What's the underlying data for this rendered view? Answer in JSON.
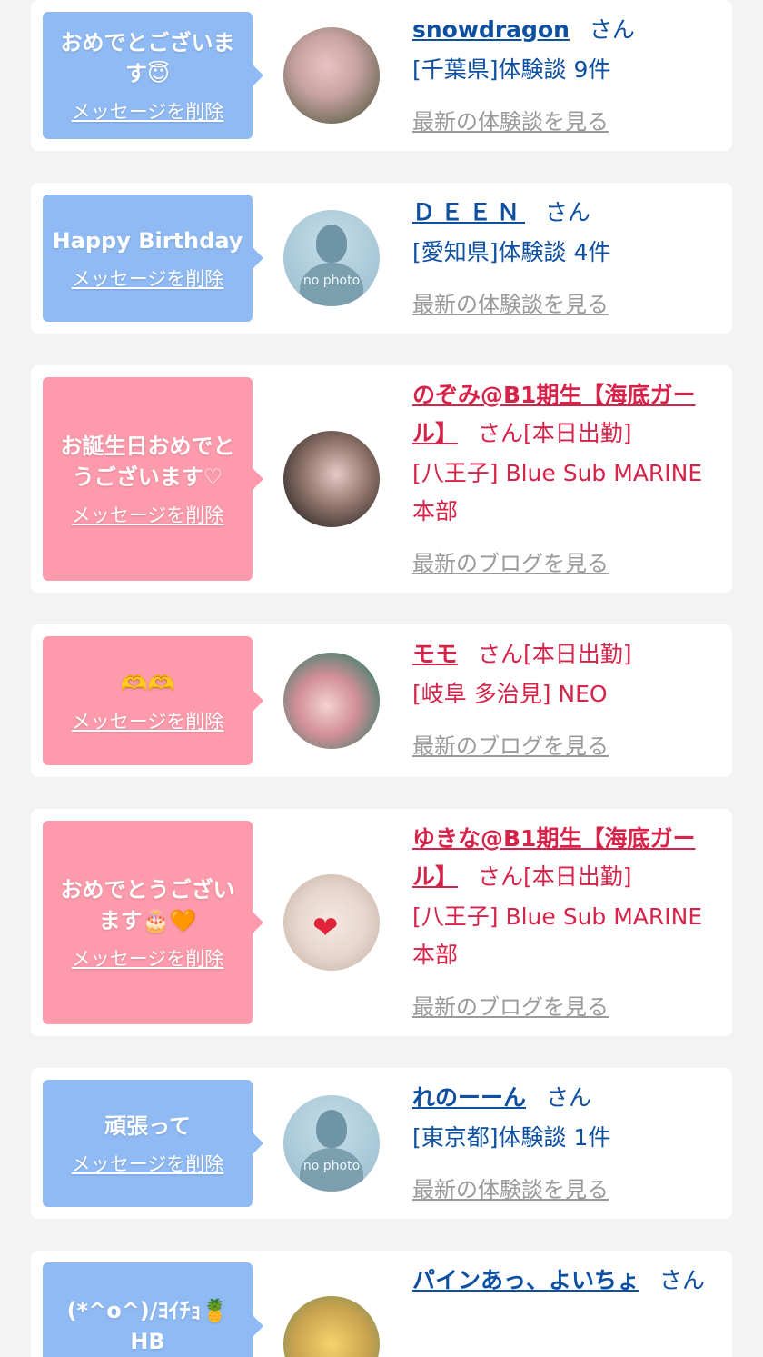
{
  "labels": {
    "delete": "メッセージを削除",
    "san": "さん",
    "latest_review": "最新の体験談を見る",
    "latest_blog": "最新のブログを見る",
    "no_photo": "no photo",
    "on_duty": "[本日出勤]"
  },
  "cards": [
    {
      "message": "おめでとございます😇",
      "name": "snowdragon",
      "detail": "[千葉県]体験談 9件",
      "avatar": "user-photo"
    },
    {
      "message": "Happy Birthday",
      "name": "ＤＥＥＮ",
      "detail": "[愛知県]体験談 4件",
      "avatar": "no-photo"
    },
    {
      "message": "お誕生日おめでとうございます♡",
      "name": "のぞみ@B1期生【海底ガール】",
      "detail": "[八王子] Blue Sub MARINE本部",
      "avatar": "user-photo"
    },
    {
      "message": "🫶🫶",
      "name": "モモ",
      "detail": "[岐阜 多治見] NEO",
      "avatar": "user-photo"
    },
    {
      "message": "おめでとうございます🎂🧡",
      "name": "ゆきな@B1期生【海底ガール】",
      "detail": "[八王子] Blue Sub MARINE本部",
      "avatar": "user-photo"
    },
    {
      "message": "頑張って",
      "name": "れのーーん",
      "detail": "[東京都]体験談 1件",
      "avatar": "no-photo"
    },
    {
      "message": "(*^o^)/ﾖｲﾁｮ🍍HB",
      "name": "パインあっ、よいちょ",
      "detail": "",
      "avatar": "user-photo"
    }
  ]
}
